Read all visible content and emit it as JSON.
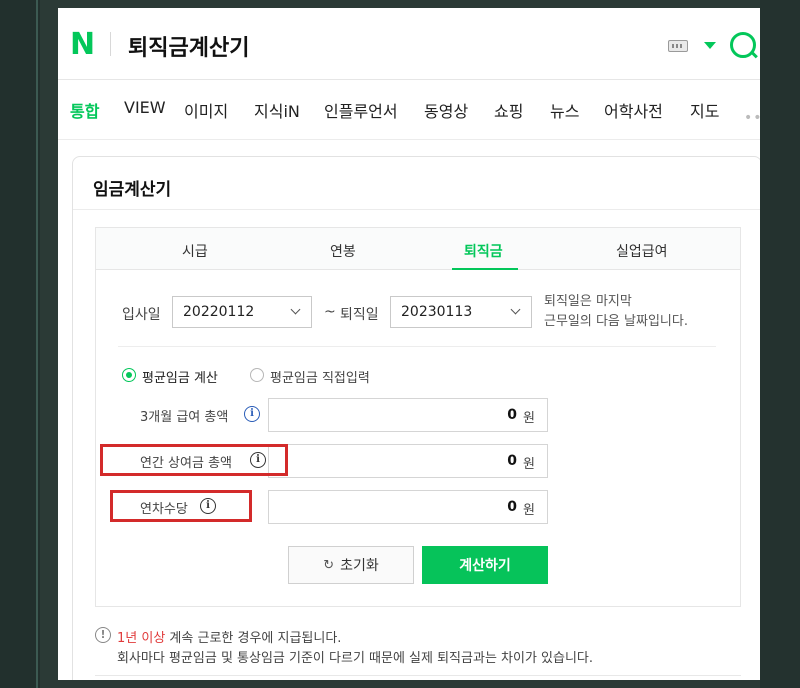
{
  "header": {
    "logo": "N",
    "query": "퇴직금계산기"
  },
  "nav_tabs": [
    "통합",
    "VIEW",
    "이미지",
    "지식iN",
    "인플루언서",
    "동영상",
    "쇼핑",
    "뉴스",
    "어학사전",
    "지도"
  ],
  "nav_more": "••",
  "card": {
    "title": "임금계산기",
    "tabs": [
      "시급",
      "연봉",
      "퇴직금",
      "실업급여"
    ],
    "active_tab": "퇴직금"
  },
  "dates": {
    "start_label": "입사일",
    "start_value": "20220112",
    "tilde": "~",
    "end_label": "퇴직일",
    "end_value": "20230113",
    "note_line1": "퇴직일은 마지막",
    "note_line2": "근무일의 다음 날짜입니다."
  },
  "mode": {
    "option1": "평균임금 계산",
    "option2": "평균임금 직접입력",
    "selected": "평균임금 계산"
  },
  "fields": [
    {
      "label": "3개월 급여 총액",
      "value": "0",
      "unit": "원"
    },
    {
      "label": "연간 상여금 총액",
      "value": "0",
      "unit": "원"
    },
    {
      "label": "연차수당",
      "value": "0",
      "unit": "원"
    }
  ],
  "info_glyph": "i",
  "buttons": {
    "reset_icon": "↻",
    "reset": "초기화",
    "calculate": "계산하기"
  },
  "footer": {
    "warn_glyph": "!",
    "line1_highlight": "1년 이상",
    "line1_rest": " 계속 근로한 경우에 지급됩니다.",
    "line2": "회사마다 평균임금 및 통상임금 기준이 다르기 때문에 실제 퇴직금과는 차이가 있습니다."
  },
  "colors": {
    "brand_green": "#03c75a",
    "highlight_red": "#d32a2a",
    "info_blue": "#2a5db8"
  }
}
